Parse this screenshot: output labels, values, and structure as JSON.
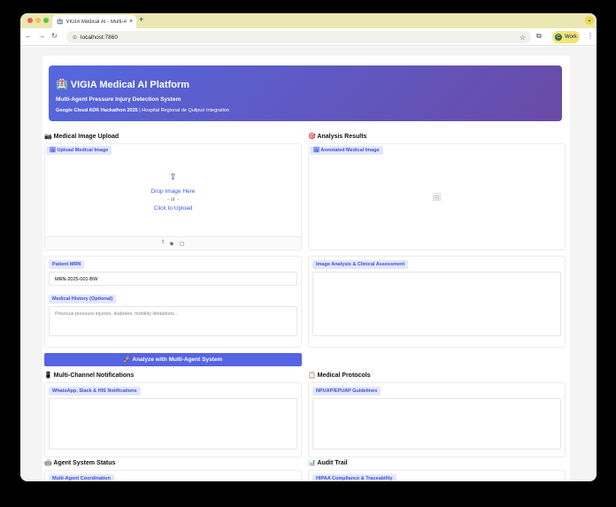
{
  "browser": {
    "tab_title": "VIGIA Medical AI - Multi-A",
    "tab_close": "×",
    "new_tab": "+",
    "url": "localhost:7860",
    "profile_label": "Work",
    "profile_initial": "C"
  },
  "header": {
    "title": "🏥 VIGIA Medical AI Platform",
    "subtitle": "Multi-Agent Pressure Injury Detection System",
    "meta_bold": "Google Cloud ADK Hackathon 2025",
    "meta_rest": " | Hospital Regional de Quilpué Integration"
  },
  "upload_section": {
    "title": "📷 Medical Image Upload",
    "chip": "🖼 Upload Medical Image",
    "drop_text": "Drop Image Here",
    "or_text": "- or -",
    "click_text": "Click to Upload"
  },
  "results_section": {
    "title": "🎯 Analysis Results",
    "chip": "🖼 Annotated Medical Image"
  },
  "patient": {
    "mrn_label": "Patient MRN",
    "mrn_value": "MRN-2025-001-BW",
    "history_label": "Medical History (Optional)",
    "history_placeholder": "Previous pressure injuries, diabetes, mobility limitations..."
  },
  "assessment": {
    "label": "Image Analysis & Clinical Assessment"
  },
  "analyze_button": "🚀 Analyze with Multi-Agent System",
  "notifications": {
    "title": "📱 Multi-Channel Notifications",
    "chip": "WhatsApp, Slack & HIS Notifications"
  },
  "protocols": {
    "title": "📋 Medical Protocols",
    "chip": "NPUAP/EPUAP Guidelines"
  },
  "agents": {
    "title": "🤖 Agent System Status",
    "chip": "Multi-Agent Coordination"
  },
  "audit": {
    "title": "📊 Audit Trail",
    "chip": "HIPAA Compliance & Traceability"
  },
  "colors": {
    "accent": "#5564e3",
    "hero_start": "#5468e0",
    "hero_end": "#6a4aa6",
    "chip_bg": "#e3e7ff"
  }
}
